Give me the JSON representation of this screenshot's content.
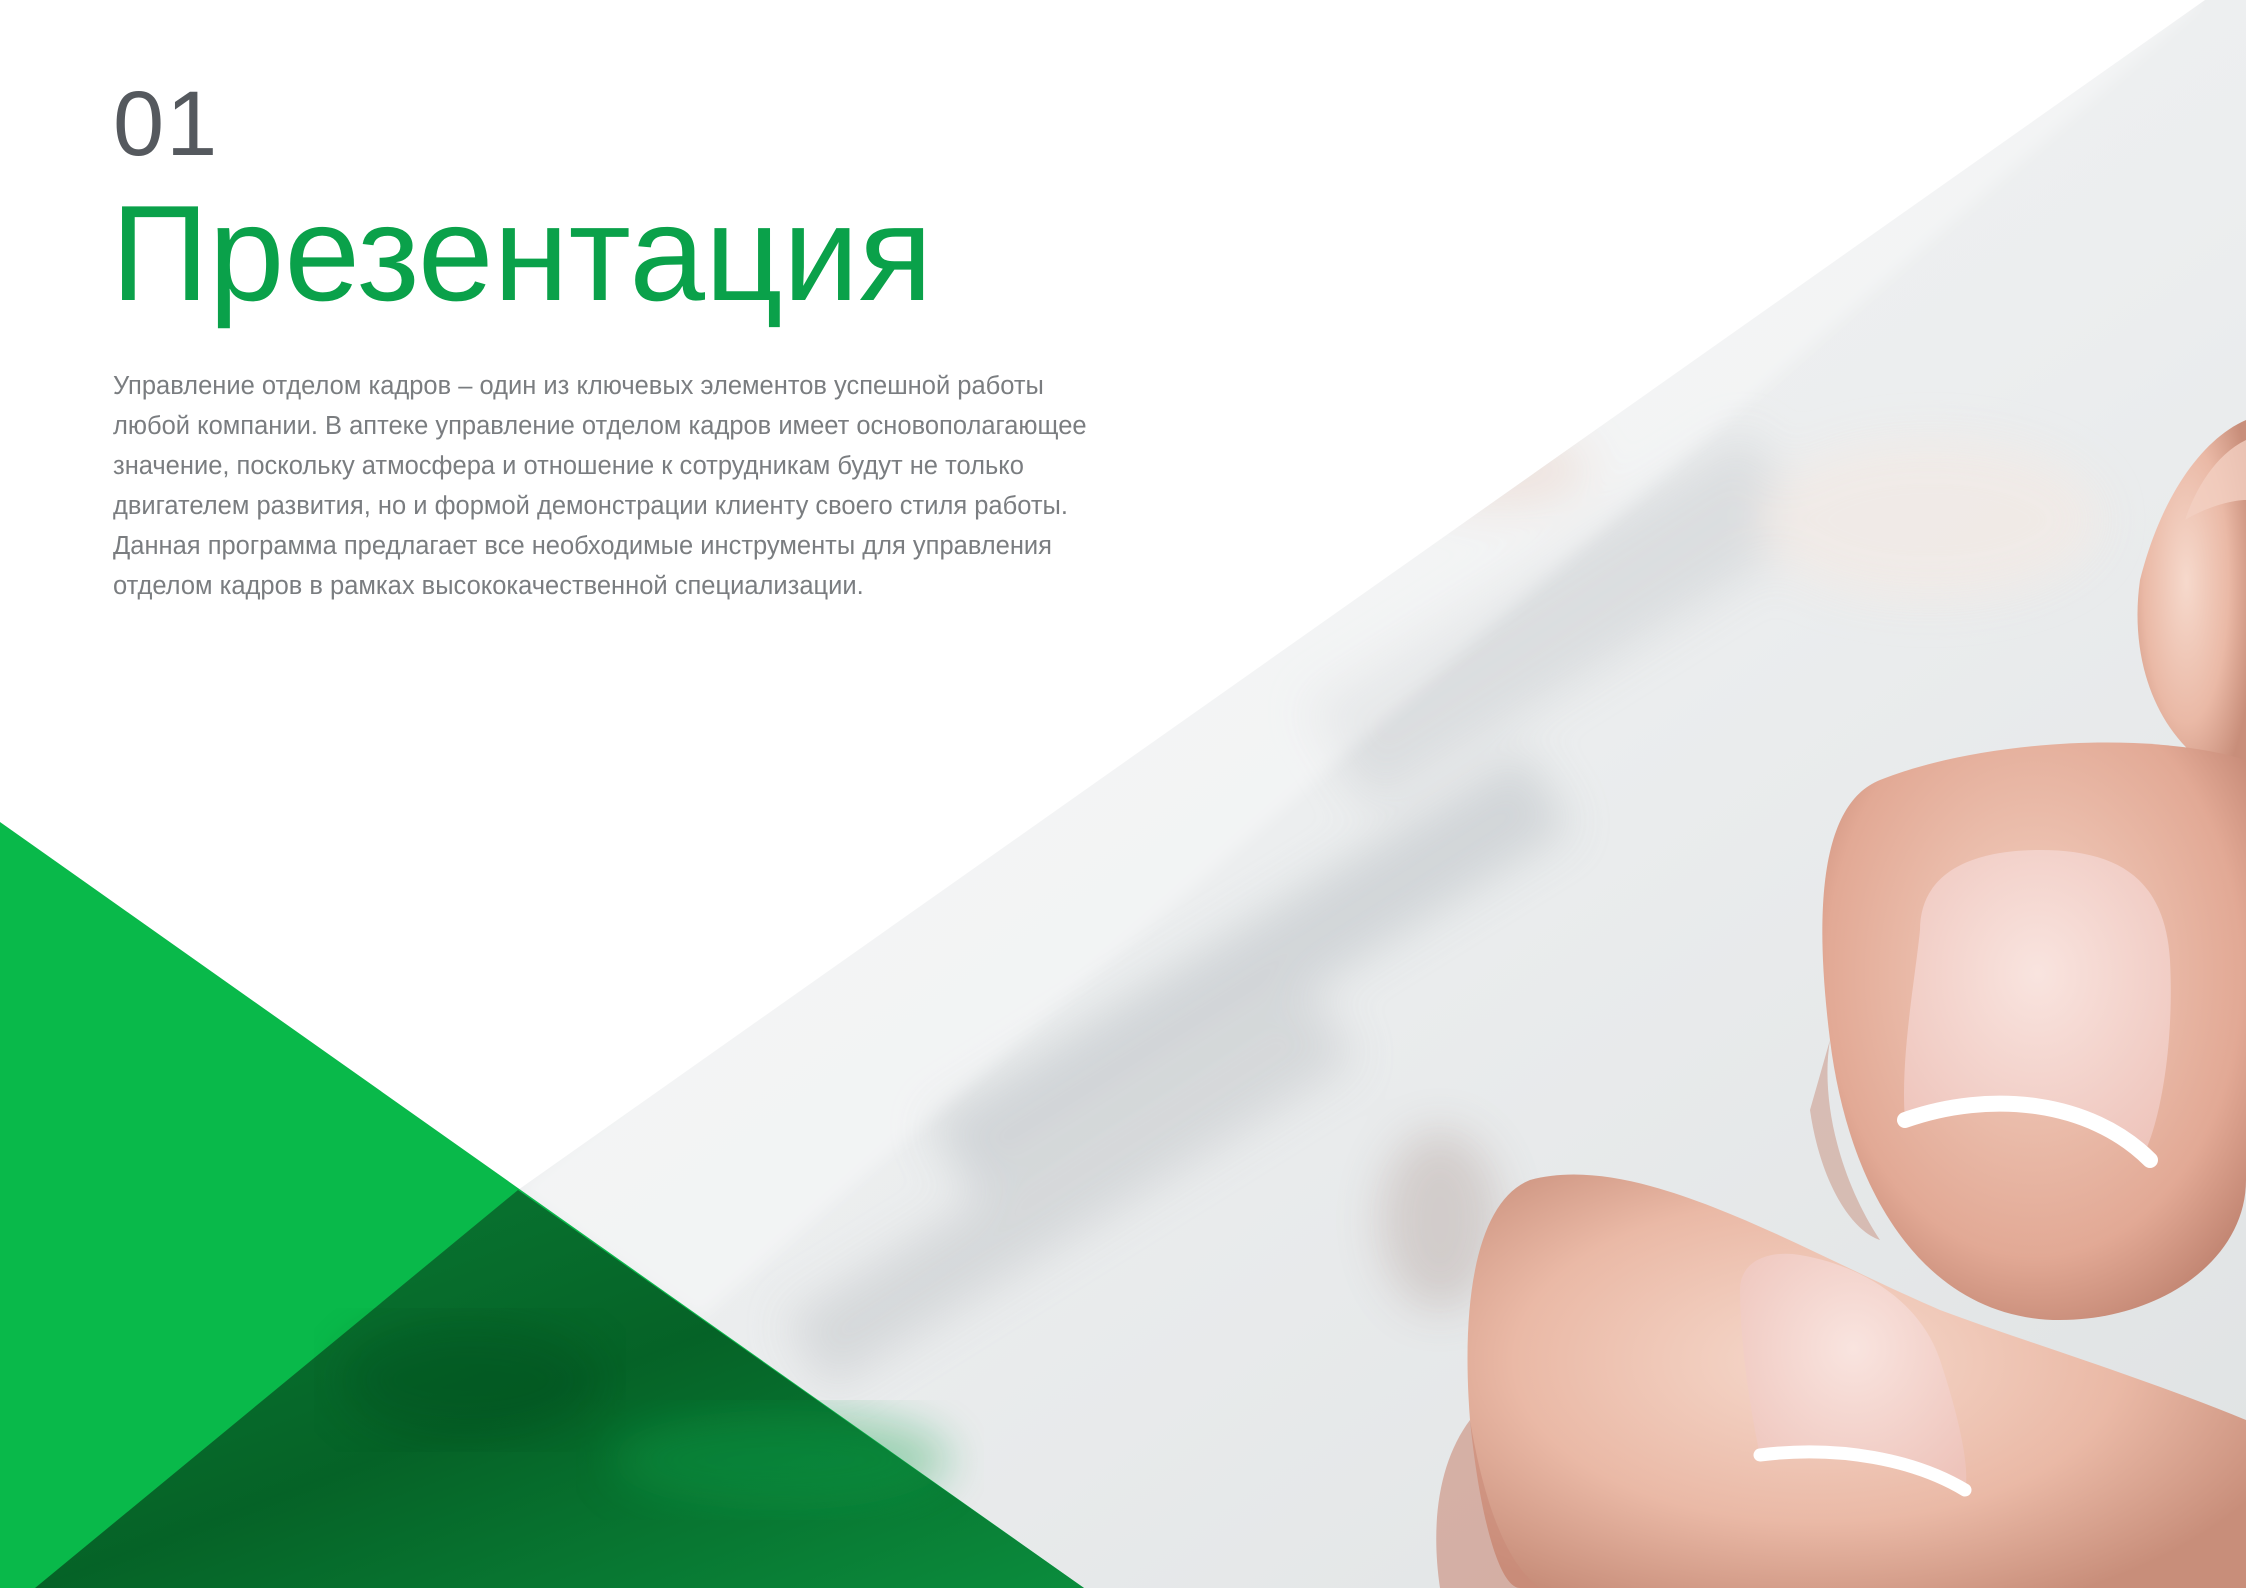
{
  "section": {
    "number": "01",
    "title": "Презентация"
  },
  "intro": {
    "lines": [
      "Управление отделом кадров – один из ключевых элементов успешной работы",
      "любой компании. В аптеке управление отделом кадров имеет основополагающее",
      "значение, поскольку атмосфера и отношение к сотрудникам будут не только",
      "двигателем развития, но и формой демонстрации клиенту своего стиля работы.",
      "Данная программа предлагает все необходимые инструменты для управления",
      "отделом кадров в рамках высококачественной специализации."
    ]
  },
  "colors": {
    "accent_green": "#0aa14a",
    "triangle_green": "#09b94a",
    "number_gray": "#55595e",
    "body_gray": "#7a7d80"
  },
  "image": {
    "subject": "photo-hand-fingers-touching"
  }
}
